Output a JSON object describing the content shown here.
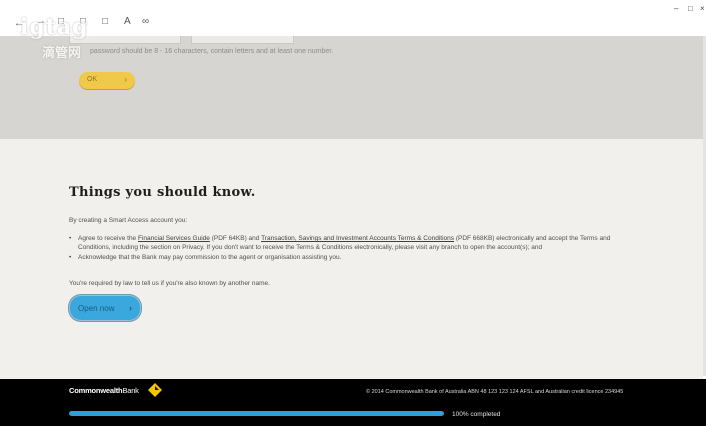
{
  "browser": {
    "back": "←",
    "forward": "←",
    "tabs_icon": "□",
    "reading_icon": "□",
    "font_icon": "A",
    "share_icon": "∞",
    "minimize": "–",
    "restore": "□",
    "close": "×"
  },
  "watermark": {
    "en": "igtag",
    "cn": "滴管网"
  },
  "password": {
    "hint": "password should be 8 - 16 characters, contain letters and at least one number.",
    "ok_label": "OK",
    "ok_chevron": "›"
  },
  "info": {
    "heading": "Things you should know.",
    "intro": "By creating a Smart Access account you:",
    "bullet1": {
      "pre": "Agree to receive the ",
      "link1": "Financial Services Guide",
      "mid1": " (PDF 64KB) and ",
      "link2": "Transaction, Savings and Investment Accounts Terms & Conditions",
      "post": " (PDF 668KB) electronically and accept the Terms and Conditions, including the section on Privacy. If you don't want to receive the Terms & Conditions electronically, please visit any branch to open the account(s); and"
    },
    "bullet2": "Acknowledge that the Bank may pay commission to the agent or organisation assisting you.",
    "law_note": "You're required by law to tell us if you're also known by another name.",
    "open_button": "Open now",
    "open_chevron": "›"
  },
  "footer": {
    "brand_bold": "Commonwealth",
    "brand_rest": "Bank",
    "copyright": "© 2014 Commonwealth Bank of Australia ABN 48 123 123 124 AFSL and Australian credit licence 234945",
    "progress_label": "100% completed",
    "progress_fraction": 1.0
  },
  "colors": {
    "top_grey": "#d6d5d1",
    "info_bg": "#f1f0ec",
    "ok_yellow": "#f0c84a",
    "open_blue": "#3aa8dc",
    "progress_blue": "#2d9fd9",
    "logo_yellow": "#f7c600"
  }
}
